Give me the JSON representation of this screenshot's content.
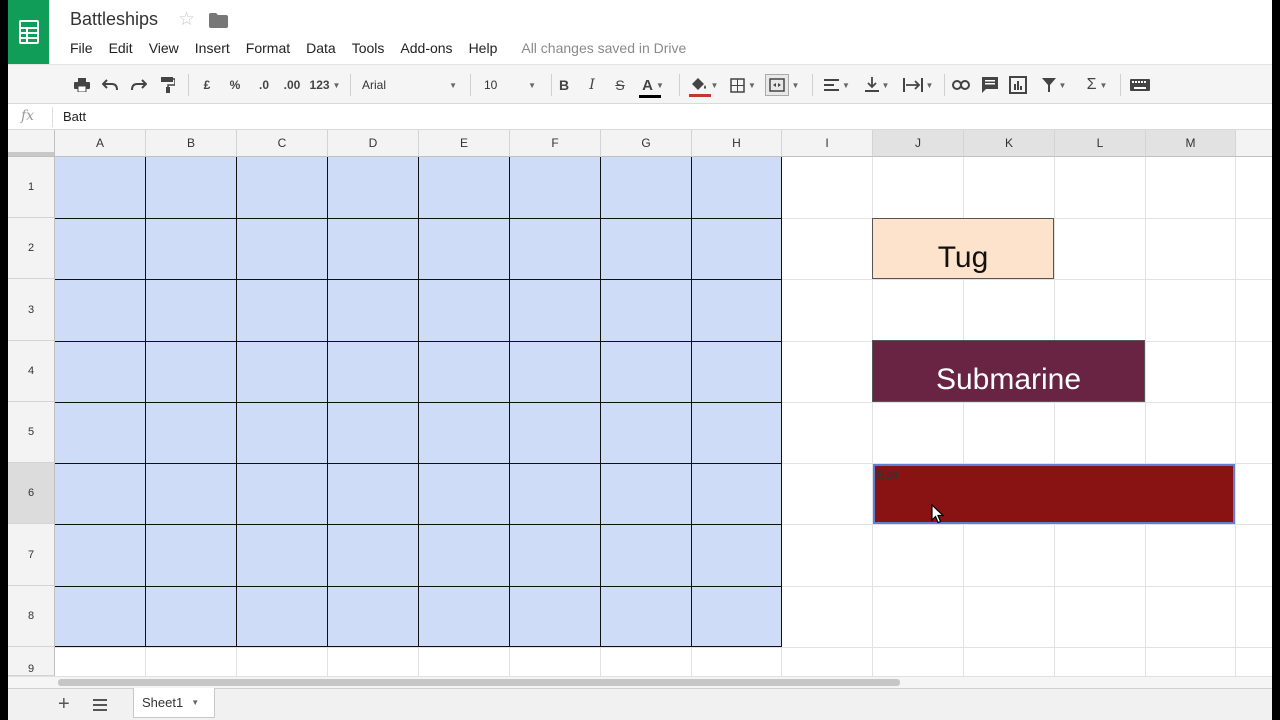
{
  "app": {
    "doc_title": "Battleships",
    "save_status": "All changes saved in Drive",
    "brand_color": "#0f9d58"
  },
  "menu": [
    "File",
    "Edit",
    "View",
    "Insert",
    "Format",
    "Data",
    "Tools",
    "Add-ons",
    "Help"
  ],
  "toolbar": {
    "currency": "£",
    "percent": "%",
    "decrease_decimal": ".0",
    "increase_decimal": ".00",
    "more_formats": "123",
    "font": "Arial",
    "font_size": "10",
    "bold": "B",
    "italic": "I",
    "strike": "S",
    "text_color": "A",
    "sum": "Σ"
  },
  "formula_bar": {
    "fx": "fx",
    "value": "Batt"
  },
  "grid": {
    "columns": [
      "A",
      "B",
      "C",
      "D",
      "E",
      "F",
      "G",
      "H",
      "I",
      "J",
      "K",
      "L",
      "M"
    ],
    "selected_column": "J",
    "rows": [
      "1",
      "2",
      "3",
      "4",
      "5",
      "6",
      "7",
      "8",
      "9"
    ],
    "selected_row": "6",
    "board_fill": "#cfdcf7"
  },
  "ships": {
    "tug": {
      "label": "Tug",
      "color": "#fde2cc"
    },
    "submarine": {
      "label": "Submarine",
      "color": "#692444"
    },
    "battleship": {
      "editing_text": "Batt",
      "color": "#891212"
    }
  },
  "sheets": {
    "add_label": "+",
    "active_tab": "Sheet1"
  }
}
